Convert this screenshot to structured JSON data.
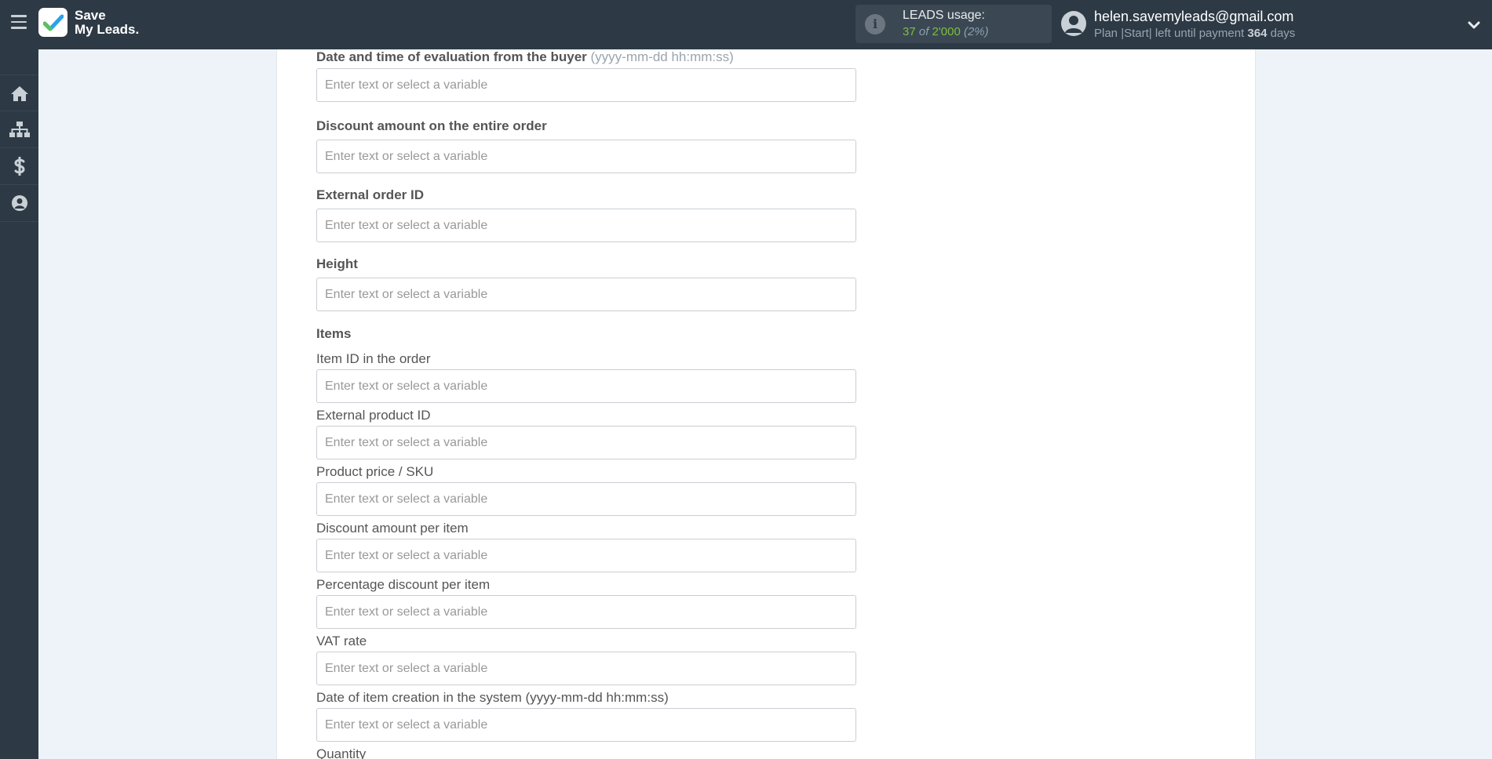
{
  "brand": {
    "line1": "Save",
    "line2": "My Leads."
  },
  "leads_usage": {
    "title": "LEADS usage:",
    "used": "37",
    "of_label": "of",
    "total": "2'000",
    "percent": "(2%)"
  },
  "user": {
    "email": "helen.savemyleads@gmail.com",
    "plan_text": "Plan |Start| left until payment",
    "days_left": "364",
    "days_label": "days"
  },
  "sidebar": {
    "items": [
      {
        "name": "home",
        "icon": "home-icon"
      },
      {
        "name": "connections",
        "icon": "sitemap-icon"
      },
      {
        "name": "billing",
        "icon": "dollar-icon"
      },
      {
        "name": "account",
        "icon": "user-circle-icon"
      }
    ]
  },
  "form": {
    "placeholder": "Enter text or select a variable",
    "eval_date": {
      "label": "Date and time of evaluation from the buyer",
      "hint": "(yyyy-mm-dd hh:mm:ss)",
      "value": ""
    },
    "discount_order": {
      "label": "Discount amount on the entire order",
      "value": ""
    },
    "external_order_id": {
      "label": "External order ID",
      "value": ""
    },
    "height": {
      "label": "Height",
      "value": ""
    },
    "items_title": "Items",
    "item_id": {
      "label": "Item ID in the order",
      "value": ""
    },
    "external_product_id": {
      "label": "External product ID",
      "value": ""
    },
    "product_price": {
      "label": "Product price / SKU",
      "value": ""
    },
    "discount_item": {
      "label": "Discount amount per item",
      "value": ""
    },
    "percent_discount": {
      "label": "Percentage discount per item",
      "value": ""
    },
    "vat_rate": {
      "label": "VAT rate",
      "value": ""
    },
    "item_creation_date": {
      "label": "Date of item creation in the system (yyyy-mm-dd hh:mm:ss)",
      "value": ""
    },
    "quantity": {
      "label": "Quantity",
      "value": ""
    }
  },
  "colors": {
    "topbar": "#2d3a45",
    "accent_green": "#7cbf3f",
    "page_bg": "#eef3f9"
  }
}
